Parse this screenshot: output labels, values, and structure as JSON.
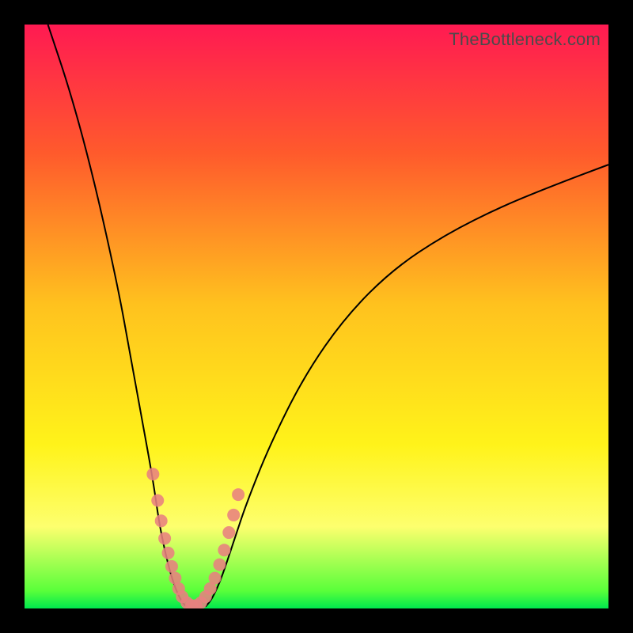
{
  "watermark": "TheBottleneck.com",
  "chart_data": {
    "type": "line",
    "title": "",
    "xlabel": "",
    "ylabel": "",
    "xlim": [
      0,
      100
    ],
    "ylim": [
      0,
      100
    ],
    "gradient_stops": [
      {
        "pos": 0,
        "color": "#ff1a52"
      },
      {
        "pos": 22,
        "color": "#ff5a2c"
      },
      {
        "pos": 48,
        "color": "#ffc21e"
      },
      {
        "pos": 72,
        "color": "#fff31a"
      },
      {
        "pos": 86,
        "color": "#fdff6e"
      },
      {
        "pos": 97,
        "color": "#59ff3a"
      },
      {
        "pos": 100,
        "color": "#00e84e"
      }
    ],
    "series": [
      {
        "name": "bottleneck-curve-left",
        "x": [
          4,
          8,
          12,
          16,
          18,
          20,
          22,
          23,
          24,
          25,
          26,
          27,
          27.8
        ],
        "y": [
          100,
          88,
          73,
          55,
          44,
          33,
          22,
          15,
          10,
          6,
          3,
          1,
          0.3
        ]
      },
      {
        "name": "bottleneck-curve-right",
        "x": [
          31,
          32,
          33,
          34,
          36,
          38,
          42,
          48,
          55,
          63,
          72,
          82,
          92,
          100
        ],
        "y": [
          0.3,
          1.5,
          3.5,
          6,
          12,
          18,
          28,
          40,
          50,
          58,
          64,
          69,
          73,
          76
        ]
      }
    ],
    "markers": {
      "name": "sample-points",
      "x": [
        22.0,
        22.8,
        23.4,
        24.0,
        24.6,
        25.2,
        25.8,
        26.4,
        27.0,
        27.8,
        28.6,
        29.4,
        30.2,
        31.0,
        31.8,
        32.6,
        33.4,
        34.2,
        35.0,
        35.8,
        36.6
      ],
      "y": [
        23.0,
        18.5,
        15.0,
        12.0,
        9.5,
        7.2,
        5.2,
        3.4,
        2.0,
        1.0,
        0.5,
        0.5,
        1.0,
        2.0,
        3.4,
        5.2,
        7.5,
        10.0,
        13.0,
        16.0,
        19.5
      ]
    }
  }
}
